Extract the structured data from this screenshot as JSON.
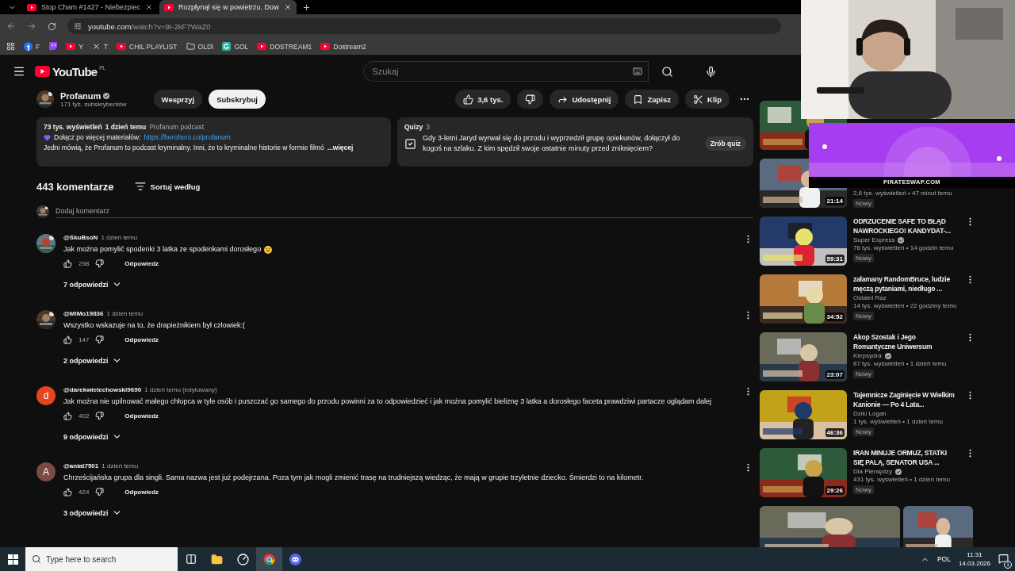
{
  "browser": {
    "tabs": [
      {
        "title": "Stop Cham #1427 - Niebezpiec",
        "selected": false
      },
      {
        "title": "Rozpłynął się w powietrzu. Dow",
        "selected": true
      }
    ],
    "address": {
      "host": "youtube.com",
      "path": "/watch?v=9I-2kF7WaZ0"
    },
    "bookmarks": [
      {
        "kind": "facebook",
        "label": "F"
      },
      {
        "kind": "twitch"
      },
      {
        "kind": "youtube",
        "label": "Y"
      },
      {
        "kind": "x",
        "label": "T"
      },
      {
        "kind": "youtube",
        "label": "CHIL PLAYLIST"
      },
      {
        "kind": "folder",
        "label": "OLD\\"
      },
      {
        "kind": "g",
        "label": "GOL"
      },
      {
        "kind": "youtube",
        "label": "DOSTREAM1"
      },
      {
        "kind": "youtube",
        "label": "Dostream2"
      }
    ]
  },
  "header": {
    "logo": "YouTube",
    "region": "PL",
    "search": {
      "placeholder": "Szukaj"
    }
  },
  "channel": {
    "name": "Profanum",
    "verified": true,
    "subscribers": "171 tys. subskrybentów",
    "buttons": [
      {
        "label": "Wesprzyj",
        "kind": "plain"
      },
      {
        "label": "Subskrybuj",
        "kind": "primary"
      }
    ]
  },
  "actions": {
    "likes": "3,6 tys.",
    "share": "Udostępnij",
    "save": "Zapisz",
    "clip": "Klip"
  },
  "description": {
    "views": "73 tys. wyświetleń",
    "date": "1 dzień temu",
    "tag": "Profanum podcast",
    "promo": "Dołącz po więcej materiałów:",
    "link": "https://herohero.co/profanum",
    "text": "Jedni mówią, że Profanum to podcast kryminalny. Inni, że to kryminalne historie w formie filmó",
    "more": "...więcej"
  },
  "quiz": {
    "title": "Quizy",
    "count": "3",
    "question": "Gdy 3-letni Jaryd wyrwał się do przodu i wyprzedził grupę opiekunów, dołączył do kogoś na szlaku. Z kim spędził swoje ostatnie minuty przed zniknięciem?",
    "button": "Zrób quiz"
  },
  "comments_header": {
    "count": "443 komentarze",
    "sort": "Sortuj według",
    "add_placeholder": "Dodaj komentarz"
  },
  "comments": [
    {
      "author": "@SkuBsoN",
      "time": "1 dzień temu",
      "text": "Jak można pomylić spodenki 3 latka ze spodenkami dorosłego",
      "emoji": true,
      "likes": "298",
      "reply": "Odpowiedz",
      "replies": "7 odpowiedzi"
    },
    {
      "author": "@MiMo19836",
      "time": "1 dzień temu",
      "text": "Wszystko wskazuje na to, że drapieżnikiem był człowiek:(",
      "emoji": false,
      "likes": "147",
      "reply": "Odpowiedz",
      "replies": "2 odpowiedzi"
    },
    {
      "avatar": {
        "kind": "letter",
        "letter": "d",
        "color": "#e5461f"
      },
      "author": "@darekwielechowski9690",
      "time": "1 dzień temu (edytowany)",
      "text": "Jak można nie upilnować małego chłopca w tyle osób i puszczać go samego do przodu powinni za to odpowiedzieć i jak można pomylić bieliznę 3 latka a dorosłego faceta prawdziwi partacze oglądam dalej",
      "emoji": false,
      "likes": "402",
      "reply": "Odpowiedz",
      "replies": "9 odpowiedzi"
    },
    {
      "avatar": {
        "kind": "letter",
        "letter": "A",
        "color": "#7b4a40"
      },
      "author": "@aniat7501",
      "time": "1 dzień temu",
      "text": "Chrześcijańska grupa dla singli. Sama nazwa jest już podejrzana. Poza tym jak mogli zmienić trasę na trudniejszą wiedząc, że mają w grupie trzyletnie dziecko. Śmierdzi to na kilometr.",
      "emoji": false,
      "likes": "424",
      "reply": "Odpowiedz",
      "replies": "3 odpowiedzi"
    }
  ],
  "sidebar": [
    {
      "kind": "video"
    },
    {
      "kind": "video",
      "duration": "21:14",
      "meta": "2,6 tys. wyświetleń • 47 minut temu",
      "badge": "Nowy"
    },
    {
      "kind": "video",
      "duration": "59:31",
      "title": "ODRZUCENIE SAFE TO BŁĄD NAWROCKIEGO! KANDYDAT-...",
      "channel": "Super Express",
      "verified": true,
      "meta": "76 tys. wyświetleń • 14 godzin temu",
      "badge": "Nowy"
    },
    {
      "kind": "video",
      "duration": "34:52",
      "title": "załamany RandomBruce, ludzie męczą pytaniami, niedługo ...",
      "channel": "Ostatni Raz",
      "verified": false,
      "meta": "14 tys. wyświetleń • 22 godziny temu",
      "badge": "Nowy"
    },
    {
      "kind": "video",
      "duration": "23:07",
      "title": "Akop Szostak i Jego Romantyczne Uniwersum",
      "channel": "Klepsydra",
      "verified": true,
      "meta": "87 tys. wyświetleń • 1 dzień temu",
      "badge": "Nowy"
    },
    {
      "kind": "video",
      "duration": "46:36",
      "title": "Tajemnicze Zaginięcie W Wielkim Kanionie — Po 4 Lata...",
      "channel": "Dziki Logan",
      "verified": false,
      "meta": "1 tys. wyświetleń • 1 dzień temu",
      "badge": "Nowy"
    },
    {
      "kind": "video",
      "duration": "29:26",
      "title": "IRAN MINUJE ORMUZ, STATKI SIĘ PALĄ, SENATOR USA ...",
      "channel": "Dla Pieniędzy",
      "verified": true,
      "meta": "431 tys. wyświetleń • 1 dzień temu",
      "badge": "Nowy"
    },
    {
      "kind": "shelf"
    }
  ],
  "overlay": {
    "banner": "PIRATESWAP.COM"
  },
  "taskbar": {
    "search_placeholder": "Type here to search",
    "language": "POL",
    "time": "11:31",
    "date": "14.03.2026",
    "notifications": "1"
  }
}
